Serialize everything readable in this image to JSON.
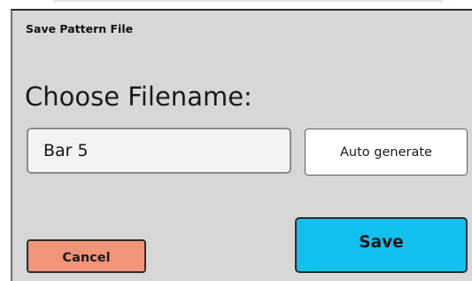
{
  "dialog": {
    "title": "Save Pattern File",
    "prompt": "Choose Filename:",
    "filename_input": {
      "value": "Bar 5",
      "placeholder": ""
    },
    "buttons": {
      "auto_generate_label": "Auto generate",
      "cancel_label": "Cancel",
      "save_label": "Save"
    }
  },
  "colors": {
    "dialog_background": "#d7d7d7",
    "cancel_button": "#f0957a",
    "save_button": "#10c1f0",
    "auto_generate_button": "#ffffff",
    "input_background": "#f3f3f3"
  }
}
